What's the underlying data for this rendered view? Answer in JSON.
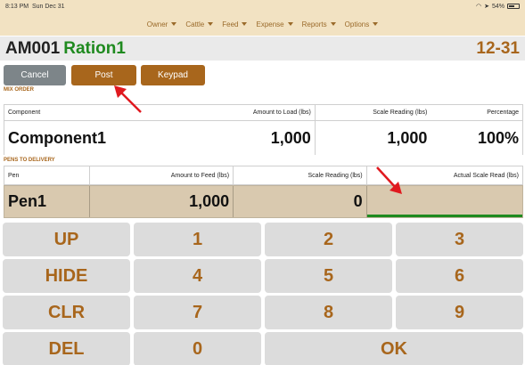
{
  "status_bar": {
    "time": "8:13 PM",
    "date": "Sun Dec 31",
    "battery": "54%"
  },
  "nav": {
    "items": [
      {
        "label": "Owner"
      },
      {
        "label": "Cattle"
      },
      {
        "label": "Feed"
      },
      {
        "label": "Expense"
      },
      {
        "label": "Reports"
      },
      {
        "label": "Options"
      }
    ]
  },
  "header": {
    "code": "AM001",
    "ration": "Ration1",
    "date": "12-31"
  },
  "actions": {
    "cancel": "Cancel",
    "post": "Post",
    "keypad": "Keypad"
  },
  "mix_order": {
    "label": "MIX ORDER",
    "columns": [
      "Component",
      "Amount to Load (lbs)",
      "Scale Reading (lbs)",
      "Percentage"
    ],
    "row": {
      "component": "Component1",
      "amount": "1,000",
      "scale": "1,000",
      "percentage": "100%"
    }
  },
  "pens": {
    "label": "PENS TO DELIVERY",
    "columns": [
      "Pen",
      "Amount to Feed (lbs)",
      "Scale Reading (lbs)",
      "Actual Scale Read (lbs)"
    ],
    "row": {
      "pen": "Pen1",
      "amount": "1,000",
      "scale": "0",
      "actual": ""
    }
  },
  "keypad": {
    "keys": [
      "UP",
      "1",
      "2",
      "3",
      "HIDE",
      "4",
      "5",
      "6",
      "CLR",
      "7",
      "8",
      "9",
      "DEL",
      "0",
      "OK"
    ]
  },
  "colors": {
    "accent": "#a8661c",
    "green": "#1f8a1f",
    "arrow": "#e0191f"
  }
}
